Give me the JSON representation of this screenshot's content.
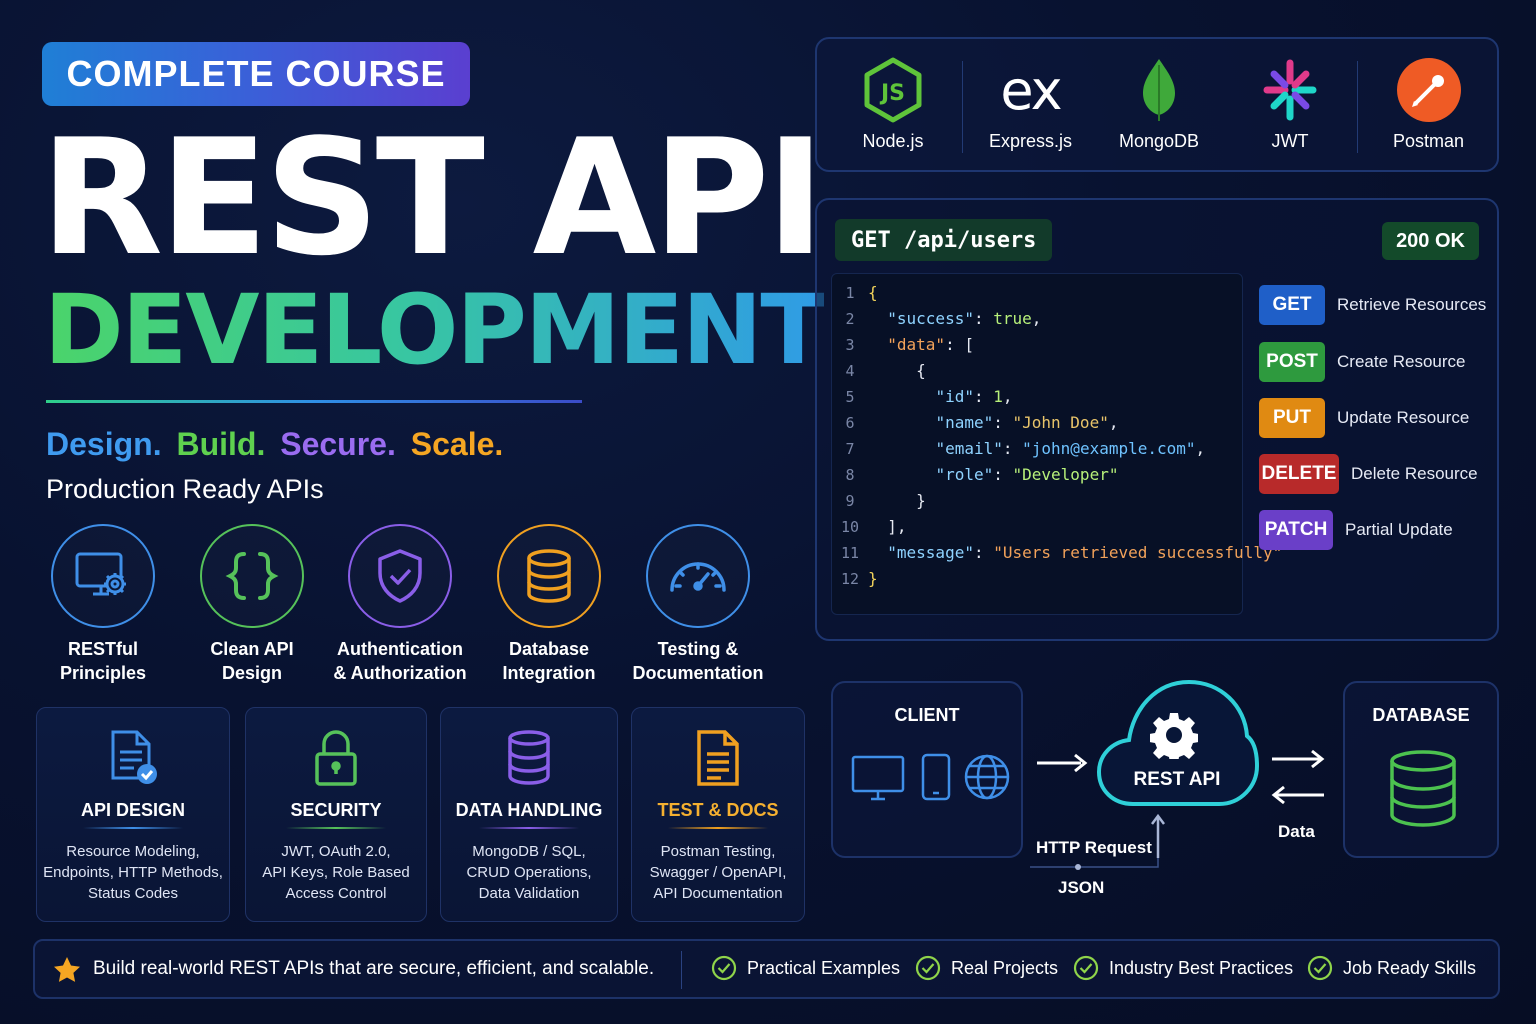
{
  "badge": "COMPLETE COURSE",
  "title_line1": "REST API",
  "title_line2": "DEVELOPMENT",
  "tagline": [
    {
      "text": "Design.",
      "color": "#3f9bf0"
    },
    {
      "text": "Build.",
      "color": "#5fd14f"
    },
    {
      "text": "Secure.",
      "color": "#9a6cf0"
    },
    {
      "text": "Scale.",
      "color": "#f5a623"
    }
  ],
  "subtagline": "Production Ready APIs",
  "features": [
    {
      "label_line1": "RESTful",
      "label_line2": "Principles",
      "icon": "monitor-gear-icon",
      "color": "#3f8fe8"
    },
    {
      "label_line1": "Clean API",
      "label_line2": "Design",
      "icon": "curly-braces-icon",
      "color": "#56c25a"
    },
    {
      "label_line1": "Authentication",
      "label_line2": "& Authorization",
      "icon": "shield-check-icon",
      "color": "#8a5ee8"
    },
    {
      "label_line1": "Database",
      "label_line2": "Integration",
      "icon": "database-icon",
      "color": "#f0a020"
    },
    {
      "label_line1": "Testing &",
      "label_line2": "Documentation",
      "icon": "gauge-icon",
      "color": "#3f8fe8"
    }
  ],
  "cards": [
    {
      "title": "API DESIGN",
      "icon": "document-check-icon",
      "accent": "#3f8fe8",
      "title_color": "#ffffff",
      "desc": [
        "Resource Modeling,",
        "Endpoints, HTTP Methods,",
        "Status Codes"
      ]
    },
    {
      "title": "SECURITY",
      "icon": "lock-icon",
      "accent": "#56c25a",
      "title_color": "#ffffff",
      "desc": [
        "JWT, OAuth 2.0,",
        "API Keys, Role Based",
        "Access Control"
      ]
    },
    {
      "title": "DATA HANDLING",
      "icon": "database-icon",
      "accent": "#8a5ee8",
      "title_color": "#ffffff",
      "desc": [
        "MongoDB / SQL,",
        "CRUD Operations,",
        "Data Validation"
      ]
    },
    {
      "title": "TEST & DOCS",
      "icon": "document-lines-icon",
      "accent": "#f0a020",
      "title_color": "#f5b030",
      "desc": [
        "Postman Testing,",
        "Swagger / OpenAPI,",
        "API Documentation"
      ]
    }
  ],
  "tech": [
    {
      "name": "Node.js",
      "icon": "nodejs-icon"
    },
    {
      "name": "Express.js",
      "icon": "express-icon",
      "mark": "ex"
    },
    {
      "name": "MongoDB",
      "icon": "mongodb-leaf-icon"
    },
    {
      "name": "JWT",
      "icon": "jwt-icon"
    },
    {
      "name": "Postman",
      "icon": "postman-icon"
    }
  ],
  "request": {
    "endpoint": "GET /api/users",
    "status": "200 OK"
  },
  "code_lines": [
    {
      "n": "1",
      "text": "{"
    },
    {
      "n": "2",
      "text": "\"success\": true,"
    },
    {
      "n": "3",
      "text": "\"data\": ["
    },
    {
      "n": "4",
      "text": "{"
    },
    {
      "n": "5",
      "text": "\"id\": 1,"
    },
    {
      "n": "6",
      "text": "\"name\": \"John Doe\","
    },
    {
      "n": "7",
      "text": "\"email\": \"john@example.com\","
    },
    {
      "n": "8",
      "text": "\"role\": \"Developer\""
    },
    {
      "n": "9",
      "text": "}"
    },
    {
      "n": "10",
      "text": "],"
    },
    {
      "n": "11",
      "text": "\"message\": \"Users retrieved successfully\""
    },
    {
      "n": "12",
      "text": "}"
    }
  ],
  "methods": [
    {
      "name": "GET",
      "desc": "Retrieve Resources",
      "color": "#1f5fc8"
    },
    {
      "name": "POST",
      "desc": "Create Resource",
      "color": "#2e9a3e"
    },
    {
      "name": "PUT",
      "desc": "Update Resource",
      "color": "#e08a12"
    },
    {
      "name": "DELETE",
      "desc": "Delete Resource",
      "color": "#b82a2a"
    },
    {
      "name": "PATCH",
      "desc": "Partial Update",
      "color": "#6a3fc8"
    }
  ],
  "flow": {
    "client": "CLIENT",
    "api": "REST API",
    "database": "DATABASE",
    "http_request": "HTTP Request",
    "json": "JSON",
    "data": "Data"
  },
  "bottom": {
    "headline": "Build real-world REST APIs that are secure, efficient, and scalable.",
    "checks": [
      "Practical Examples",
      "Real Projects",
      "Industry Best Practices",
      "Job Ready Skills"
    ]
  }
}
